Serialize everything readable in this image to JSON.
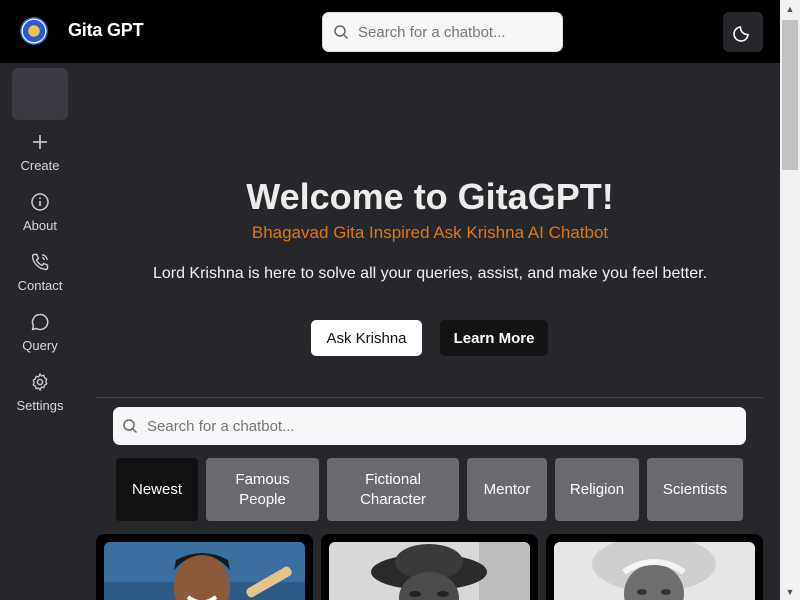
{
  "header": {
    "app_title": "Gita GPT",
    "search_placeholder": "Search for a chatbot...",
    "logo_icon": "mandala-logo-icon",
    "theme_icon": "moon-icon"
  },
  "sidebar": {
    "items": [
      {
        "label": "Create",
        "icon": "plus-icon"
      },
      {
        "label": "About",
        "icon": "info-icon"
      },
      {
        "label": "Contact",
        "icon": "phone-icon"
      },
      {
        "label": "Query",
        "icon": "chat-bubble-icon"
      },
      {
        "label": "Settings",
        "icon": "gear-icon"
      }
    ]
  },
  "hero": {
    "title": "Welcome to GitaGPT!",
    "subtitle": "Bhagavad Gita Inspired Ask Krishna AI Chatbot",
    "text": "Lord Krishna is here to solve all your queries, assist, and make you feel better.",
    "ask_button": "Ask Krishna",
    "learn_button": "Learn More"
  },
  "main_search": {
    "placeholder": "Search for a chatbot..."
  },
  "categories": [
    {
      "label": "Newest",
      "active": true
    },
    {
      "label": "Famous People",
      "active": false
    },
    {
      "label": "Fictional Character",
      "active": false
    },
    {
      "label": "Mentor",
      "active": false
    },
    {
      "label": "Religion",
      "active": false
    },
    {
      "label": "Scientists",
      "active": false
    }
  ],
  "colors": {
    "accent": "#d97a14",
    "background": "#27262a",
    "header": "#000000"
  }
}
